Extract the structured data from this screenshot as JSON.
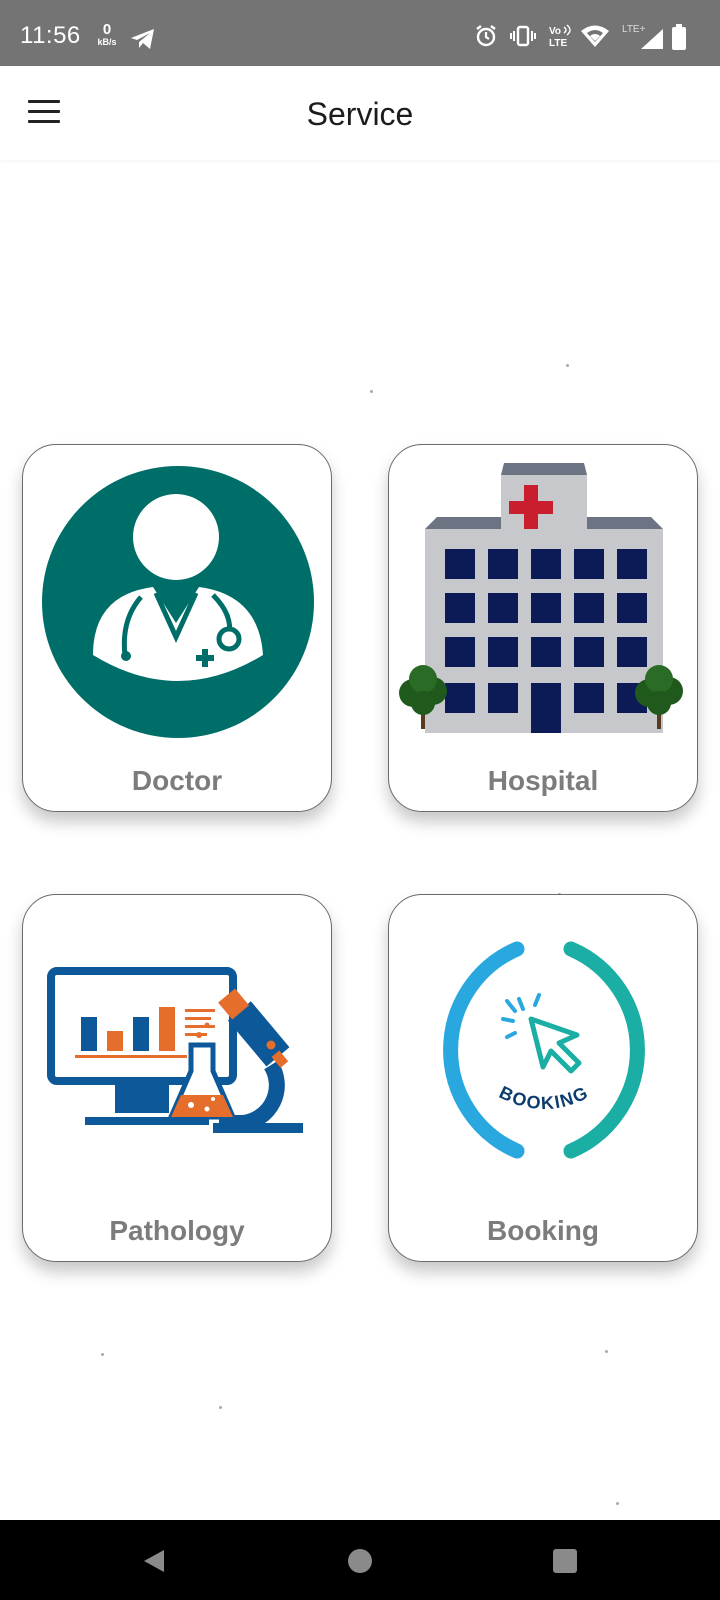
{
  "status_bar": {
    "time": "11:56",
    "net_speed_value": "0",
    "net_speed_unit": "kB/s",
    "icons": [
      "telegram-icon",
      "alarm-icon",
      "vibrate-icon",
      "volte-icon",
      "wifi-icon",
      "lte-signal-icon",
      "battery-icon"
    ],
    "volte_label": "Vo LTE",
    "lte_label": "LTE+"
  },
  "app_bar": {
    "title": "Service",
    "menu_icon": "hamburger-menu-icon"
  },
  "tiles": [
    {
      "label": "Doctor",
      "icon": "doctor-icon"
    },
    {
      "label": "Hospital",
      "icon": "hospital-icon"
    },
    {
      "label": "Pathology",
      "icon": "pathology-icon"
    },
    {
      "label": "Booking",
      "icon": "booking-icon",
      "art_text": "BOOKING"
    }
  ],
  "nav_bar": {
    "icons": [
      "back-icon",
      "home-icon",
      "recents-icon"
    ]
  },
  "colors": {
    "status_bar": "#747474",
    "doctor_teal": "#006e68",
    "hospital_window": "#0c1a55",
    "hospital_cross": "#c81e2d",
    "pathology_blue": "#0d5898",
    "pathology_orange": "#e56e2c",
    "booking_blue": "#29a8e0",
    "booking_teal": "#1aaea5",
    "label_gray": "#7c7c7c"
  }
}
